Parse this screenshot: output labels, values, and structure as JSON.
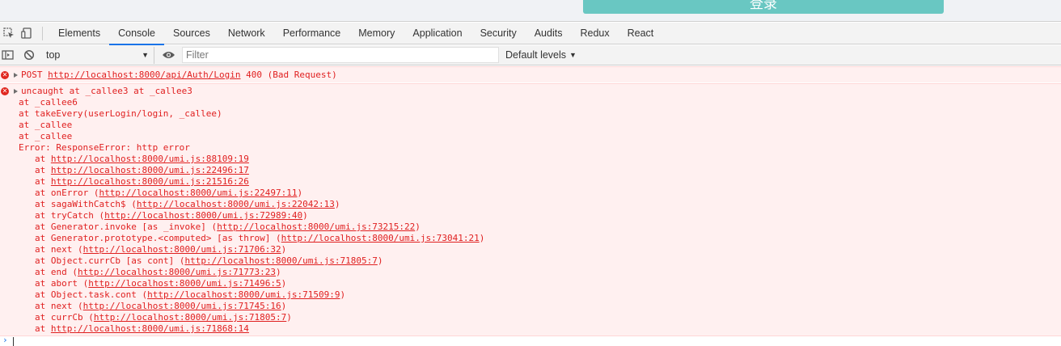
{
  "page": {
    "login_button_label": "登录"
  },
  "devtools": {
    "tabs": [
      {
        "label": "Elements"
      },
      {
        "label": "Console"
      },
      {
        "label": "Sources"
      },
      {
        "label": "Network"
      },
      {
        "label": "Performance"
      },
      {
        "label": "Memory"
      },
      {
        "label": "Application"
      },
      {
        "label": "Security"
      },
      {
        "label": "Audits"
      },
      {
        "label": "Redux"
      },
      {
        "label": "React"
      }
    ],
    "active_tab": "Console",
    "accent_color": "#1a73e8"
  },
  "toolbar": {
    "context": "top",
    "filter_placeholder": "Filter",
    "levels_label": "Default levels"
  },
  "messages": {
    "post": {
      "method": "POST",
      "url": "http://localhost:8000/api/Auth/Login",
      "status": "400 (Bad Request)"
    },
    "uncaught": {
      "head": "uncaught at _callee3 at _callee3",
      "saga_lines": [
        "at _callee6",
        "at takeEvery(userLogin/login, _callee)",
        "at _callee",
        "at _callee",
        "Error: ResponseError: http error"
      ],
      "stack": [
        {
          "prefix": "at ",
          "fn": "",
          "url": "http://localhost:8000/umi.js:88109:19"
        },
        {
          "prefix": "at ",
          "fn": "",
          "url": "http://localhost:8000/umi.js:22496:17"
        },
        {
          "prefix": "at ",
          "fn": "",
          "url": "http://localhost:8000/umi.js:21516:26"
        },
        {
          "prefix": "at ",
          "fn": "onError",
          "url": "http://localhost:8000/umi.js:22497:11"
        },
        {
          "prefix": "at ",
          "fn": "sagaWithCatch$",
          "url": "http://localhost:8000/umi.js:22042:13"
        },
        {
          "prefix": "at ",
          "fn": "tryCatch",
          "url": "http://localhost:8000/umi.js:72989:40"
        },
        {
          "prefix": "at ",
          "fn": "Generator.invoke [as _invoke]",
          "url": "http://localhost:8000/umi.js:73215:22"
        },
        {
          "prefix": "at ",
          "fn": "Generator.prototype.<computed> [as throw]",
          "url": "http://localhost:8000/umi.js:73041:21"
        },
        {
          "prefix": "at ",
          "fn": "next",
          "url": "http://localhost:8000/umi.js:71706:32"
        },
        {
          "prefix": "at ",
          "fn": "Object.currCb [as cont]",
          "url": "http://localhost:8000/umi.js:71805:7"
        },
        {
          "prefix": "at ",
          "fn": "end",
          "url": "http://localhost:8000/umi.js:71773:23"
        },
        {
          "prefix": "at ",
          "fn": "abort",
          "url": "http://localhost:8000/umi.js:71496:5"
        },
        {
          "prefix": "at ",
          "fn": "Object.task.cont",
          "url": "http://localhost:8000/umi.js:71509:9"
        },
        {
          "prefix": "at ",
          "fn": "next",
          "url": "http://localhost:8000/umi.js:71745:16"
        },
        {
          "prefix": "at ",
          "fn": "currCb",
          "url": "http://localhost:8000/umi.js:71805:7"
        },
        {
          "prefix": "at ",
          "fn": "",
          "url": "http://localhost:8000/umi.js:71868:14"
        }
      ]
    },
    "error_color": "#e02020"
  }
}
